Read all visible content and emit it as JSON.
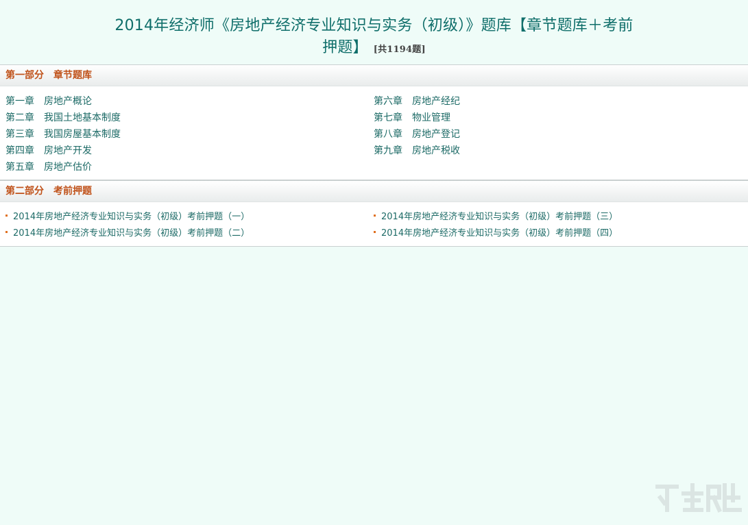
{
  "header": {
    "title_line1": "2014年经济师《房地产经济专业知识与实务（初级）》题库【章节题库＋考前",
    "title_line2": "押题】",
    "count": "[共1194题]"
  },
  "section1": {
    "heading": "第一部分　章节题库",
    "left": [
      {
        "num": "第一章",
        "name": "房地产概论"
      },
      {
        "num": "第二章",
        "name": "我国土地基本制度"
      },
      {
        "num": "第三章",
        "name": "我国房屋基本制度"
      },
      {
        "num": "第四章",
        "name": "房地产开发"
      },
      {
        "num": "第五章",
        "name": "房地产估价"
      }
    ],
    "right": [
      {
        "num": "第六章",
        "name": "房地产经纪"
      },
      {
        "num": "第七章",
        "name": "物业管理"
      },
      {
        "num": "第八章",
        "name": "房地产登记"
      },
      {
        "num": "第九章",
        "name": "房地产税收"
      }
    ]
  },
  "section2": {
    "heading": "第二部分　考前押题",
    "left": [
      "2014年房地产经济专业知识与实务（初级）考前押题（一）",
      "2014年房地产经济专业知识与实务（初级）考前押题（二）"
    ],
    "right": [
      "2014年房地产经济专业知识与实务（初级）考前押题（三）",
      "2014年房地产经济专业知识与实务（初级）考前押题（四）"
    ]
  },
  "colors": {
    "background": "#effcf8",
    "title": "#0f6e6a",
    "section_heading": "#c0521a",
    "link": "#1c6a66",
    "bullet": "#e0701f"
  }
}
